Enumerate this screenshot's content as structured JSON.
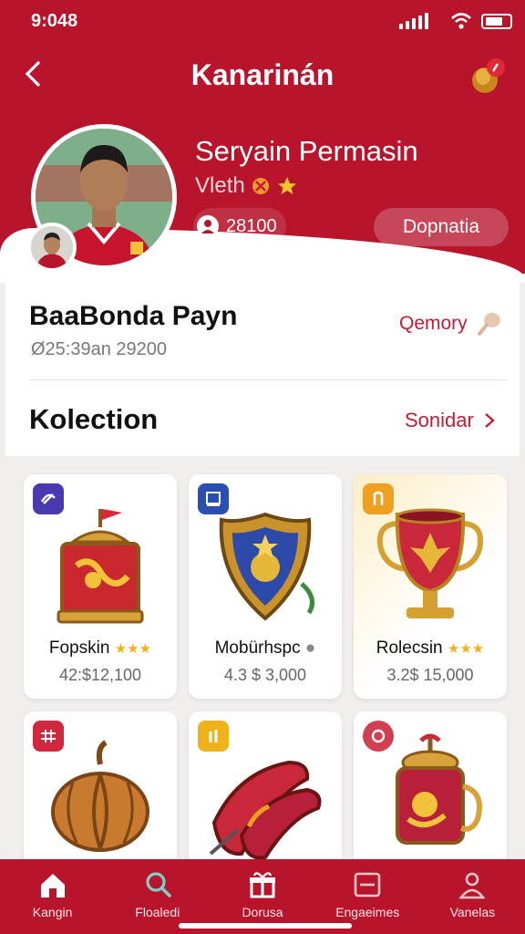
{
  "status": {
    "time": "9:048"
  },
  "header": {
    "title": "Kanarinán"
  },
  "profile": {
    "name": "Seryain Permasin",
    "subtitle": "Vleth",
    "followers": "28100",
    "action_label": "Dopnatia"
  },
  "player": {
    "name": "BaaBonda Payn",
    "meta": "Ø25:39an 29200",
    "category": "Qemory"
  },
  "collection": {
    "title": "Kolection",
    "see_all": "Sonidar",
    "items": [
      {
        "name": "Fopskin",
        "price": "42:$12,100",
        "rating": "★★★",
        "badge_color": "#4a3ab0"
      },
      {
        "name": "Mobürhspc",
        "price": "4.3 $ 3,000",
        "rating": "",
        "badge_color": "#2a4fb0"
      },
      {
        "name": "Rolecsin",
        "price": "3.2$ 15,000",
        "rating": "★★★",
        "badge_color": "#f0a020"
      },
      {
        "name": "",
        "price": "",
        "rating": "",
        "badge_color": "#d0283c"
      },
      {
        "name": "",
        "price": "",
        "rating": "",
        "badge_color": "#f0b21a"
      },
      {
        "name": "",
        "price": "",
        "rating": "",
        "badge_color": "#d04050"
      }
    ]
  },
  "nav": [
    {
      "label": "Kangin",
      "icon": "home-icon"
    },
    {
      "label": "Floaledi",
      "icon": "search-icon"
    },
    {
      "label": "Dorusa",
      "icon": "gift-icon"
    },
    {
      "label": "Engaeimes",
      "icon": "inbox-icon"
    },
    {
      "label": "Vanelas",
      "icon": "profile-icon"
    }
  ],
  "colors": {
    "brand": "#b8142c",
    "accent_text": "#c21d34",
    "star": "#f0b21a"
  }
}
